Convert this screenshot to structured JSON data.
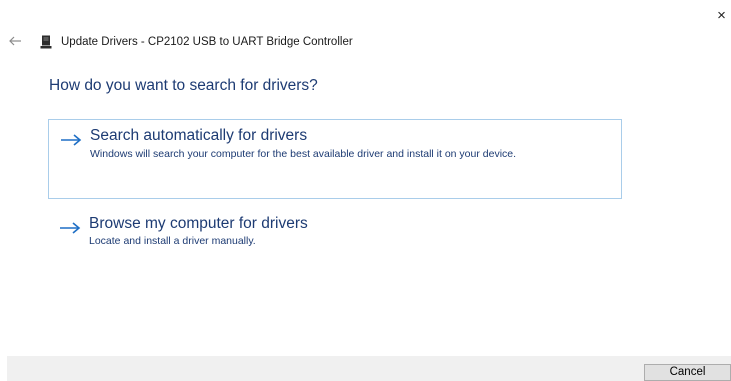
{
  "window": {
    "title": "Update Drivers - CP2102 USB to UART Bridge Controller",
    "close_glyph": "×",
    "back_icon": "back-arrow-icon",
    "device_icon": "usb-device-icon"
  },
  "main": {
    "heading": "How do you want to search for drivers?",
    "options": [
      {
        "title": "Search automatically for drivers",
        "description": "Windows will search your computer for the best available driver and install it on your device.",
        "icon": "arrow-right-icon",
        "selected": true
      },
      {
        "title": "Browse my computer for drivers",
        "description": "Locate and install a driver manually.",
        "icon": "arrow-right-icon",
        "selected": false
      }
    ]
  },
  "footer": {
    "cancel_label": "Cancel"
  },
  "colors": {
    "accent_text": "#1d3b73",
    "arrow": "#1f6fc5",
    "selected_border": "#a9cdea",
    "footer_bg": "#f0f0f0"
  }
}
